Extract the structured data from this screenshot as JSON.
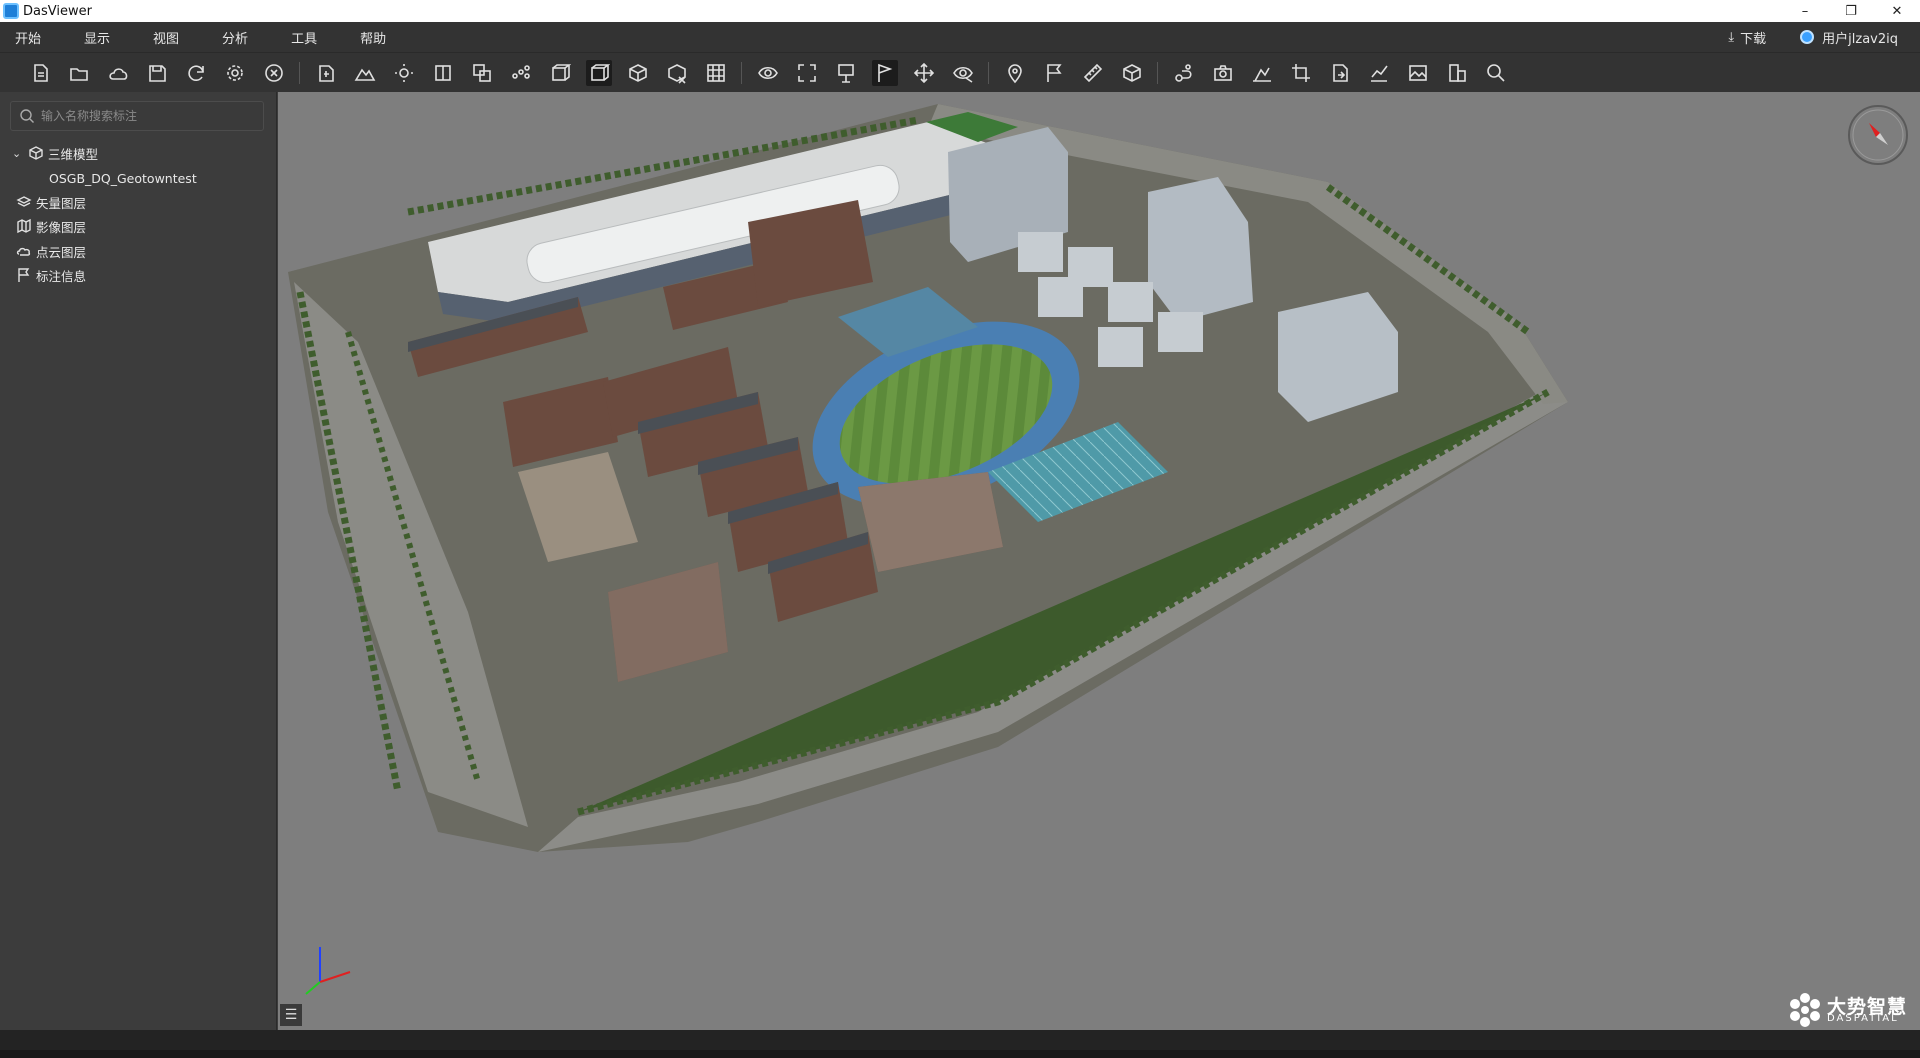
{
  "window": {
    "title": "DasViewer",
    "minimize": "–",
    "maximize": "❐",
    "close": "✕"
  },
  "menu": {
    "items": [
      "开始",
      "显示",
      "视图",
      "分析",
      "工具",
      "帮助"
    ],
    "download_label": "下载",
    "user_label": "用户jlzav2iq"
  },
  "toolbar": {
    "groups": [
      [
        "new-file-icon",
        "open-folder-icon",
        "cloud-icon",
        "save-icon",
        "refresh-icon",
        "settings-icon",
        "close-circle-icon"
      ],
      [
        "import-model-icon",
        "terrain-icon",
        "light-icon",
        "split-view-icon",
        "layer-stack-icon",
        "point-cloud-icon",
        "wireframe-box-icon",
        "solid-box-icon",
        "texture-box-icon",
        "clip-box-icon",
        "grid-icon"
      ],
      [
        "eye-rotate-icon",
        "fullscreen-icon",
        "flatten-icon",
        "flag-pin-icon",
        "move-icon",
        "visibility-icon"
      ],
      [
        "location-pin-icon",
        "flag-icon",
        "ruler-icon",
        "volume-icon"
      ],
      [
        "route-icon",
        "camera-icon",
        "profile-icon",
        "crop-icon",
        "export-icon",
        "chart-icon",
        "image-icon",
        "building-icon",
        "search-icon"
      ]
    ],
    "active": [
      "solid-box-icon",
      "flag-pin-icon"
    ]
  },
  "sidebar": {
    "search_placeholder": "输入名称搜索标注",
    "tree": [
      {
        "label": "三维模型",
        "icon": "cube-icon",
        "expanded": true
      },
      {
        "label": "OSGB_DQ_Geotowntest",
        "icon": "",
        "child": true
      },
      {
        "label": "矢量图层",
        "icon": "vector-layer-icon"
      },
      {
        "label": "影像图层",
        "icon": "map-layer-icon"
      },
      {
        "label": "点云图层",
        "icon": "point-cloud-layer-icon"
      },
      {
        "label": "标注信息",
        "icon": "annotation-flag-icon"
      }
    ]
  },
  "viewport": {
    "logo_text": "大势智慧",
    "logo_sub": "DASPATIAL"
  },
  "colors": {
    "background": "#7e7e7e",
    "panel": "#3c3c3c",
    "toolbar": "#333333"
  }
}
